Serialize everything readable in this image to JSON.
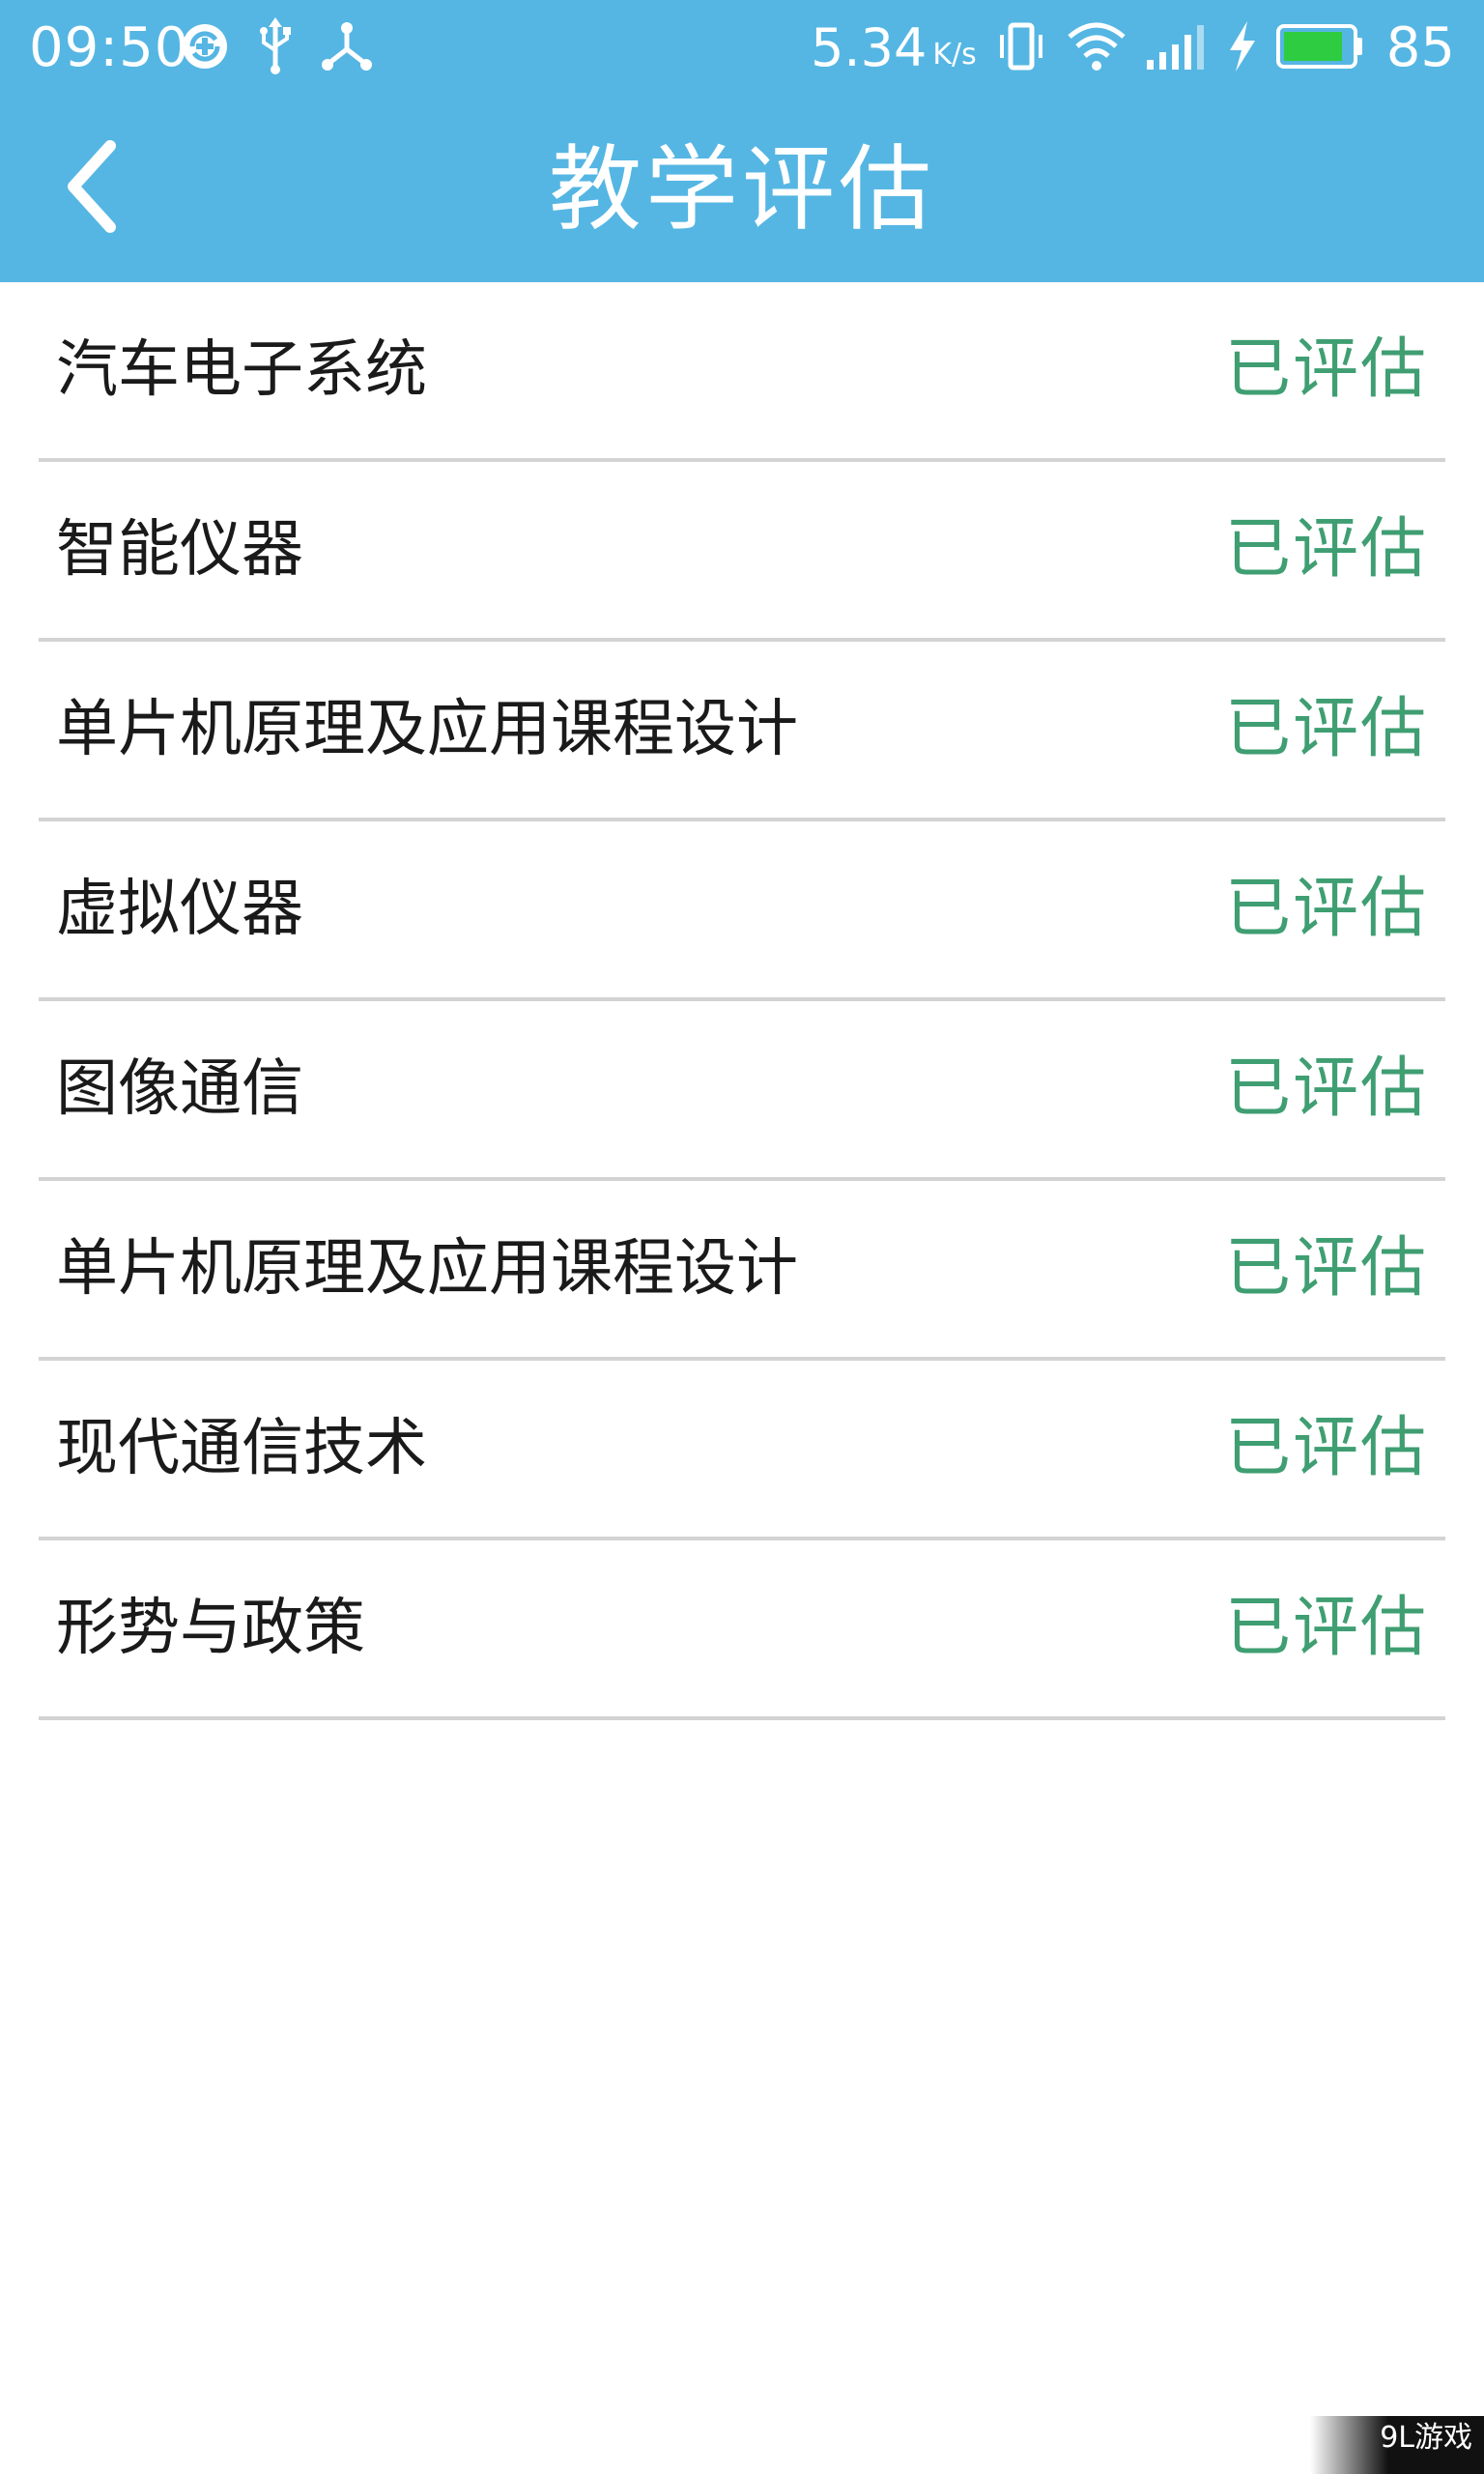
{
  "status_bar": {
    "time": "09:50",
    "net_speed": "5.34",
    "net_speed_unit": "K/s",
    "battery_level": "85",
    "battery_fill_fraction": 0.85,
    "icons": [
      "sync-icon",
      "usb-icon",
      "share-icon",
      "vibrate-icon",
      "wifi-icon",
      "signal-icon",
      "charging-icon",
      "battery-icon"
    ]
  },
  "header": {
    "title": "教学评估",
    "back_icon": "chevron-left-icon",
    "color": "#55b6e3"
  },
  "courses": [
    {
      "name": "汽车电子系统",
      "status": "已评估"
    },
    {
      "name": "智能仪器",
      "status": "已评估"
    },
    {
      "name": "单片机原理及应用课程设计",
      "status": "已评估"
    },
    {
      "name": "虚拟仪器",
      "status": "已评估"
    },
    {
      "name": "图像通信",
      "status": "已评估"
    },
    {
      "name": "单片机原理及应用课程设计",
      "status": "已评估"
    },
    {
      "name": "现代通信技术",
      "status": "已评估"
    },
    {
      "name": "形势与政策",
      "status": "已评估"
    }
  ],
  "status_color": "#3f9e72",
  "watermark": {
    "text": "9L游戏"
  }
}
